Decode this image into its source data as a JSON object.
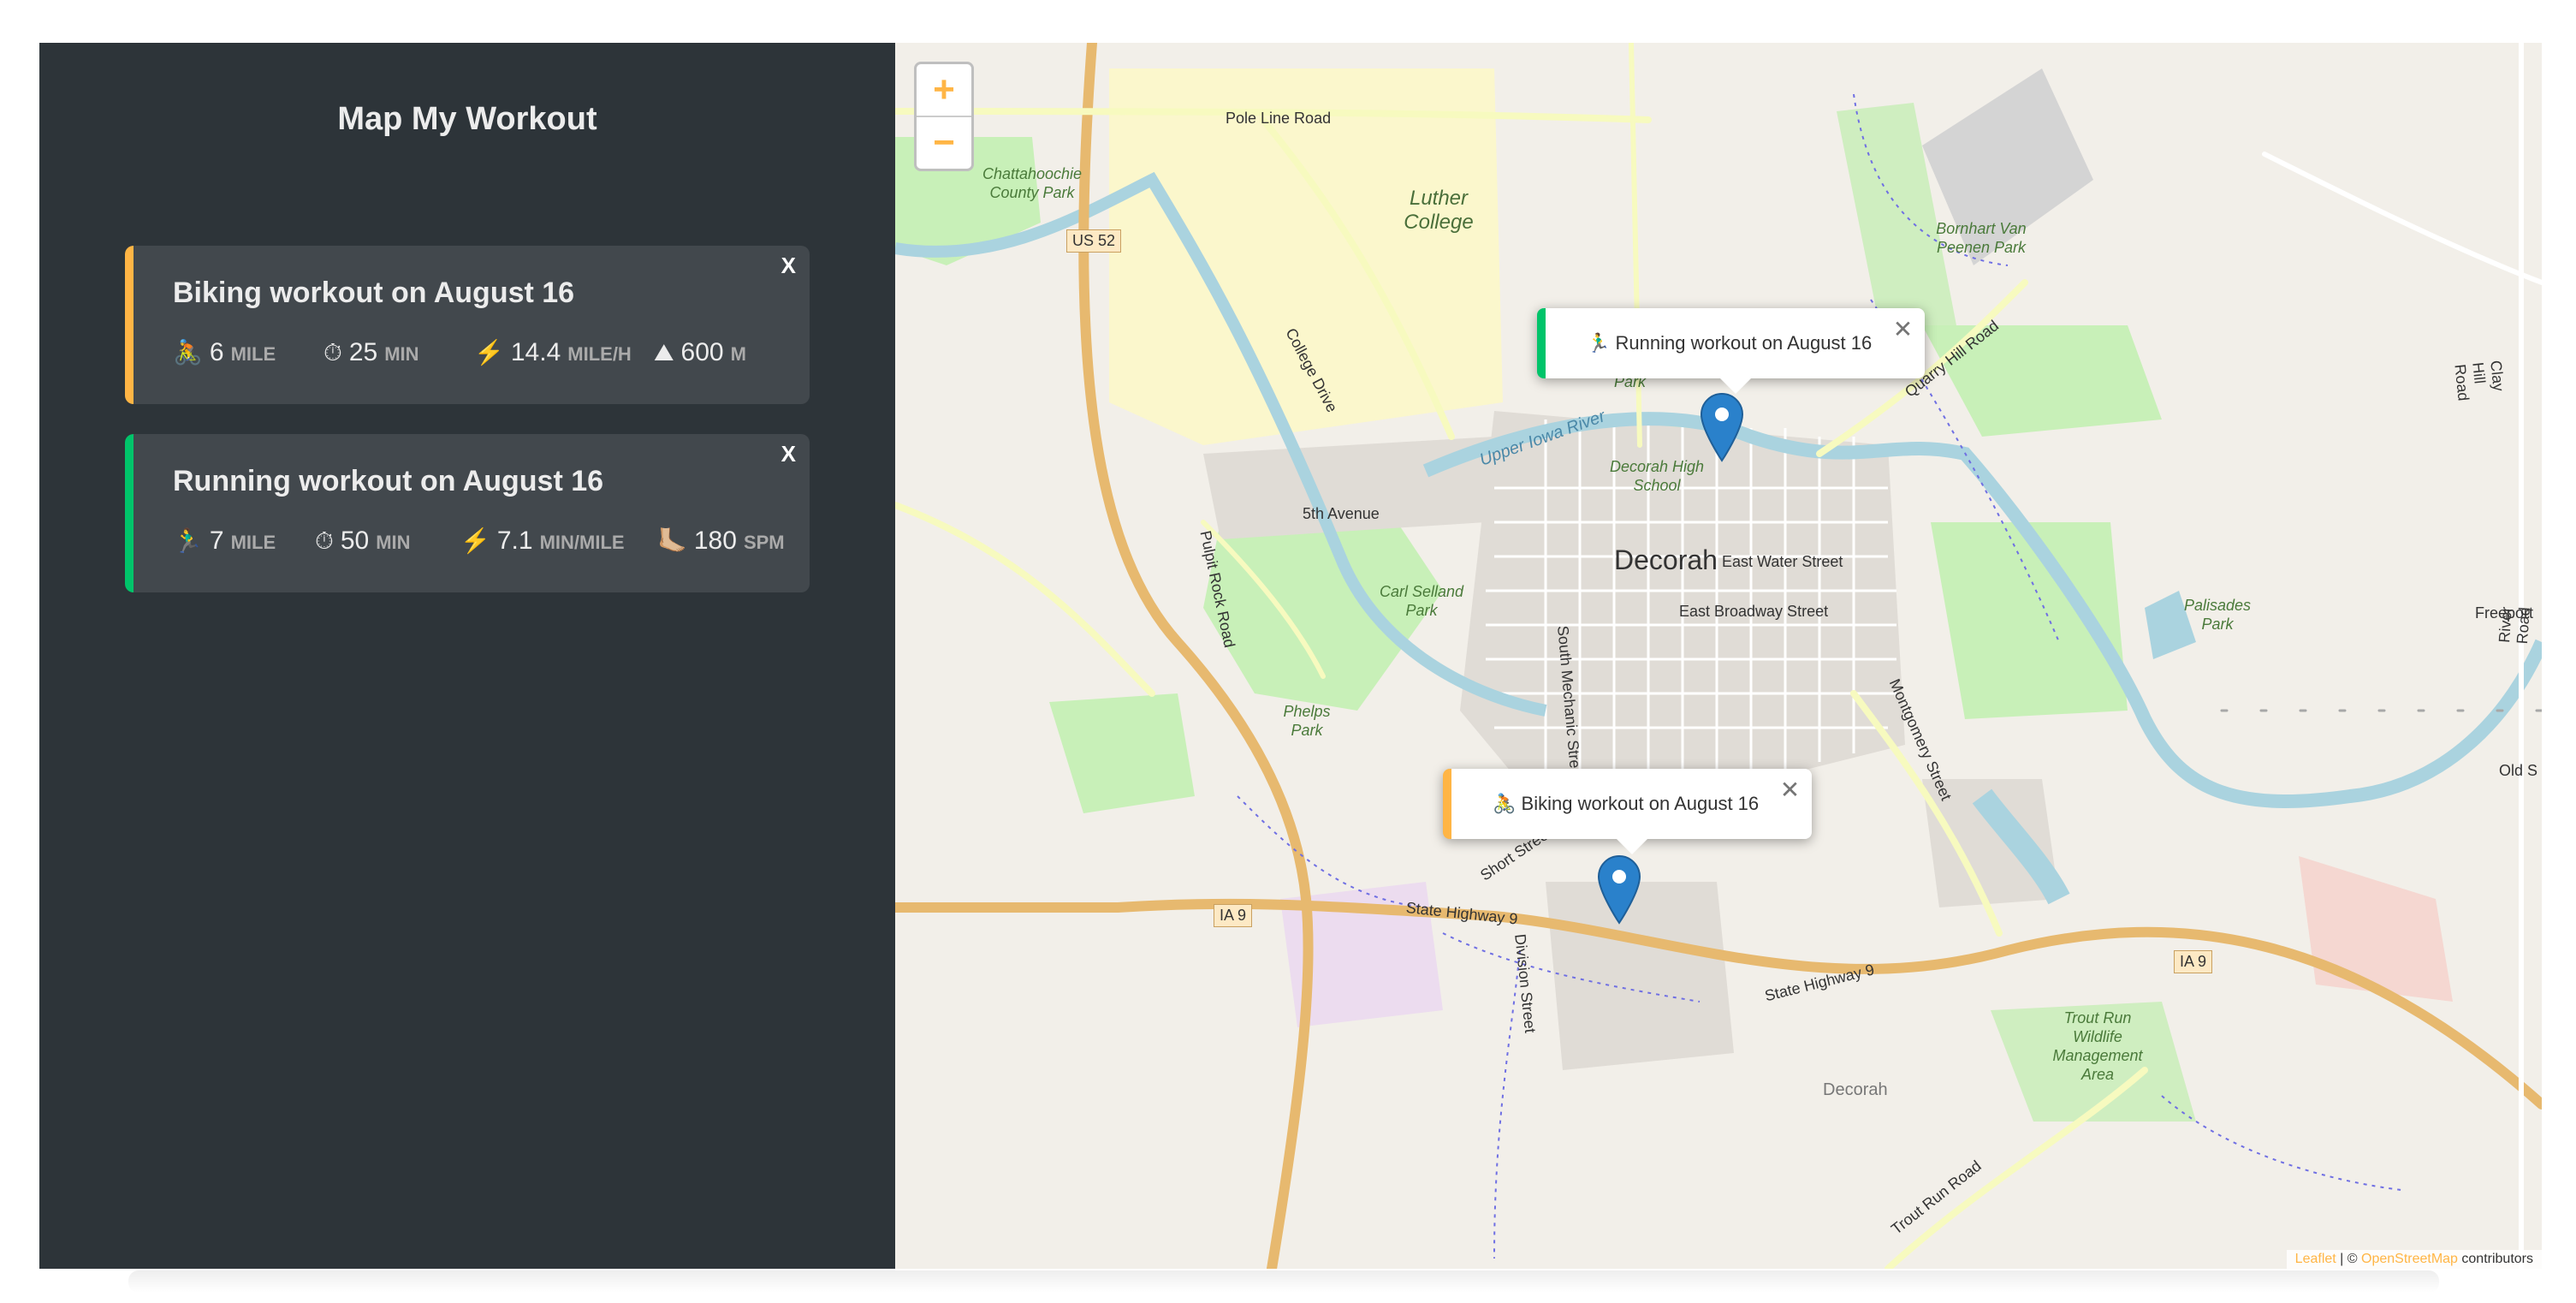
{
  "app": {
    "title": "Map My Workout"
  },
  "workouts": [
    {
      "title": "Biking workout on August 16",
      "close": "X",
      "accent": "#ffb545",
      "details": [
        {
          "icon": "🚴",
          "icon_name": "biking-icon",
          "value": "6",
          "unit": "mile"
        },
        {
          "icon": "⏱",
          "icon_name": "stopwatch-icon",
          "value": "25",
          "unit": "min"
        },
        {
          "icon": "⚡️",
          "icon_name": "lightning-icon",
          "value": "14.4",
          "unit": "mile/h"
        },
        {
          "icon": "⛰",
          "icon_name": "mountain-icon",
          "value": "600",
          "unit": "m"
        }
      ]
    },
    {
      "title": "Running workout on August 16",
      "close": "X",
      "accent": "#00c46a",
      "details": [
        {
          "icon": "🏃‍♂️",
          "icon_name": "running-icon",
          "value": "7",
          "unit": "mile"
        },
        {
          "icon": "⏱",
          "icon_name": "stopwatch-icon",
          "value": "50",
          "unit": "min"
        },
        {
          "icon": "⚡️",
          "icon_name": "lightning-icon",
          "value": "7.1",
          "unit": "min/mile"
        },
        {
          "icon": "🦶🏼",
          "icon_name": "foot-icon",
          "value": "180",
          "unit": "spm"
        }
      ]
    }
  ],
  "map": {
    "zoom_in": "+",
    "zoom_out": "−",
    "popups": {
      "running": {
        "icon": "🏃‍♂️",
        "text": "Running workout on August 16",
        "close": "✕"
      },
      "biking": {
        "icon": "🚴",
        "text": "Biking workout on August 16",
        "close": "✕"
      }
    },
    "labels": {
      "city": "Decorah",
      "luther": "Luther College",
      "chattahoochie": "Chattahoochie County Park",
      "us52": "US 52",
      "ia9_left": "IA 9",
      "ia9_right": "IA 9",
      "pole_line": "Pole Line Road",
      "college_drive": "College Drive",
      "fifth_ave": "5th Avenue",
      "pulpit_rock": "Pulpit Rock Road",
      "carl_selland": "Carl Selland Park",
      "phelps": "Phelps Park",
      "upper_iowa": "Upper Iowa River",
      "decorah_hs": "Decorah High School",
      "east_water": "East Water Street",
      "east_broadway": "East Broadway Street",
      "south_mechanic": "South Mechanic Street",
      "montgomery": "Montgomery Street",
      "palisades": "Palisades Park",
      "state_hwy_9": "State Highway 9",
      "division_st": "Division Street",
      "short_st": "Short Street",
      "quarry_hill": "Quarry Hill Road",
      "bornhart": "Bornhart Van Peenen Park",
      "trout_run_road": "Trout Run Road",
      "trout_run_wma": "Trout Run Wildlife Management Area",
      "decorah_twp": "Decorah",
      "freeport": "Freeport",
      "old_s": "Old S",
      "clay_hill": "Clay Hill Road",
      "river_road": "River Road",
      "park": "Park"
    },
    "attribution": {
      "leaflet": "Leaflet",
      "sep": " | © ",
      "osm": "OpenStreetMap",
      "rest": " contributors"
    }
  }
}
